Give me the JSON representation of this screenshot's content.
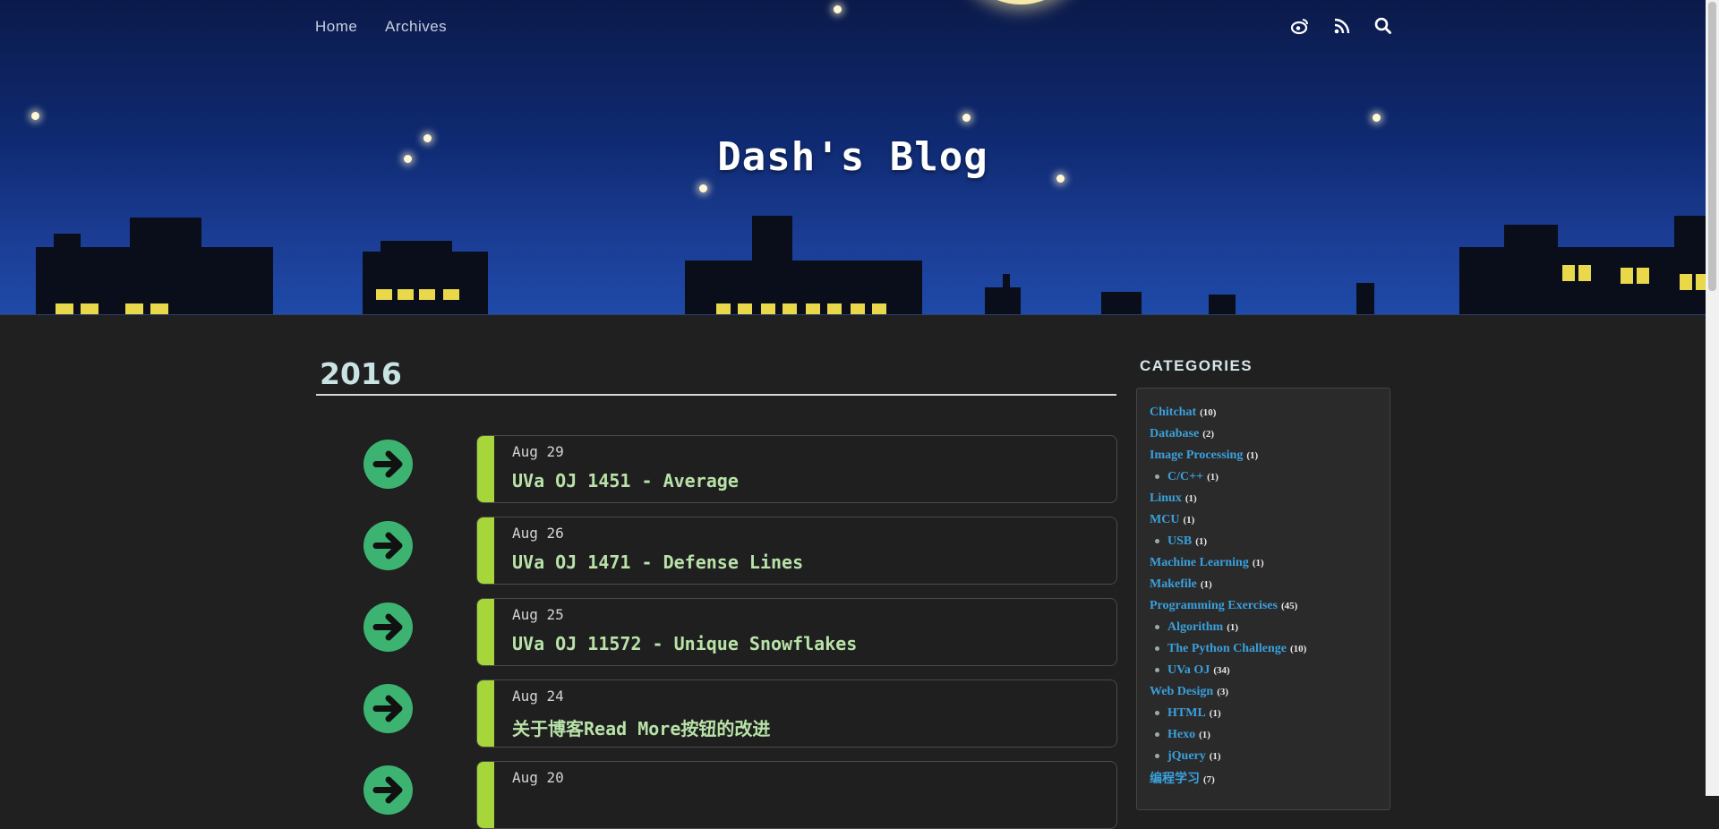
{
  "header": {
    "site_title": "Dash's Blog",
    "nav": [
      {
        "label": "Home"
      },
      {
        "label": "Archives"
      }
    ],
    "icons": [
      "weibo-icon",
      "rss-icon",
      "search-icon"
    ]
  },
  "archive": {
    "year": "2016",
    "posts": [
      {
        "date": "Aug 29",
        "title": "UVa OJ 1451 - Average"
      },
      {
        "date": "Aug 26",
        "title": "UVa OJ 1471 - Defense Lines"
      },
      {
        "date": "Aug 25",
        "title": "UVa OJ 11572 - Unique Snowflakes"
      },
      {
        "date": "Aug 24",
        "title": "关于博客Read More按钮的改进"
      },
      {
        "date": "Aug 20",
        "title": ""
      }
    ]
  },
  "sidebar": {
    "heading": "CATEGORIES",
    "categories": [
      {
        "name": "Chitchat",
        "count": "(10)",
        "child": false
      },
      {
        "name": "Database",
        "count": "(2)",
        "child": false
      },
      {
        "name": "Image Processing",
        "count": "(1)",
        "child": false
      },
      {
        "name": "C/C++",
        "count": "(1)",
        "child": true
      },
      {
        "name": "Linux",
        "count": "(1)",
        "child": false
      },
      {
        "name": "MCU",
        "count": "(1)",
        "child": false
      },
      {
        "name": "USB",
        "count": "(1)",
        "child": true
      },
      {
        "name": "Machine Learning",
        "count": "(1)",
        "child": false
      },
      {
        "name": "Makefile",
        "count": "(1)",
        "child": false
      },
      {
        "name": "Programming Exercises",
        "count": "(45)",
        "child": false
      },
      {
        "name": "Algorithm",
        "count": "(1)",
        "child": true
      },
      {
        "name": "The Python Challenge",
        "count": "(10)",
        "child": true
      },
      {
        "name": "UVa OJ",
        "count": "(34)",
        "child": true
      },
      {
        "name": "Web Design",
        "count": "(3)",
        "child": false
      },
      {
        "name": "HTML",
        "count": "(1)",
        "child": true
      },
      {
        "name": "Hexo",
        "count": "(1)",
        "child": true
      },
      {
        "name": "jQuery",
        "count": "(1)",
        "child": true
      },
      {
        "name": "编程学习",
        "count": "(7)",
        "child": false
      }
    ]
  },
  "colors": {
    "accent_stripe": "#a7d63a",
    "arrow": "#3cb371",
    "link": "#3aa0dc",
    "post_title": "#b8e2a8"
  }
}
